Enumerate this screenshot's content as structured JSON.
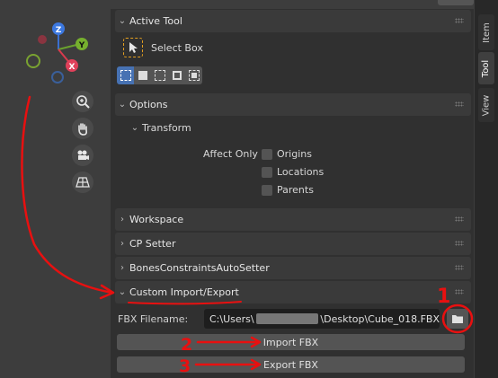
{
  "tabs": {
    "top_partial": "Options",
    "item": "Item",
    "tool": "Tool",
    "view": "View"
  },
  "gizmo": {
    "z_label": "Z",
    "y_label": "Y",
    "x_label": "X"
  },
  "active_tool": {
    "title": "Active Tool",
    "tool_name": "Select Box",
    "modes": [
      "set",
      "extend",
      "subtract",
      "difference",
      "intersect"
    ]
  },
  "options": {
    "title": "Options",
    "transform_title": "Transform",
    "affect_only_label": "Affect Only",
    "checkboxes": [
      {
        "label": "Origins",
        "checked": false
      },
      {
        "label": "Locations",
        "checked": false
      },
      {
        "label": "Parents",
        "checked": false
      }
    ]
  },
  "collapsed_panels": [
    "Workspace",
    "CP Setter",
    "BonesConstraintsAutoSetter"
  ],
  "custom_panel": {
    "title": "Custom Import/Export",
    "fbx_label": "FBX Filename:",
    "path_prefix": "C:\\Users\\",
    "path_suffix": "\\Desktop\\Cube_018.FBX",
    "import_label": "Import FBX",
    "export_label": "Export FBX"
  },
  "annotations": {
    "one": "1",
    "two": "2",
    "three": "3",
    "color": "#e81010"
  },
  "colors": {
    "panel_bg": "#303030",
    "header_bg": "#3a3a3a",
    "button_bg": "#545454",
    "accent": "#4772b3"
  }
}
